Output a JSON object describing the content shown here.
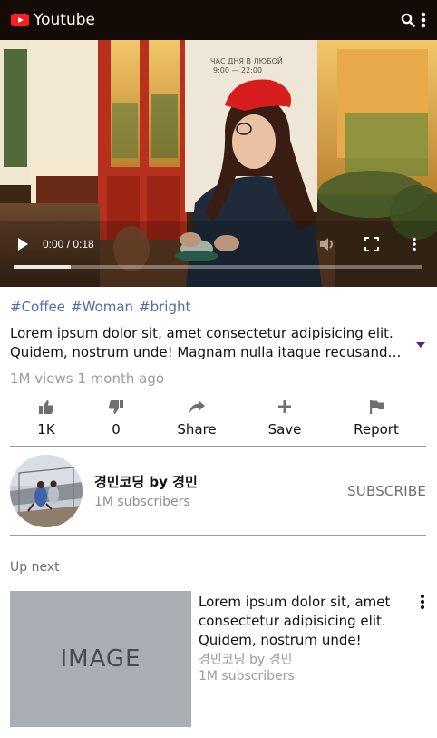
{
  "header": {
    "brand": "Youtube",
    "logo_icon": "youtube-logo-icon",
    "search_icon": "search-icon",
    "menu_icon": "more-vertical-icon"
  },
  "player": {
    "time": "0:00 / 0:18",
    "progress": 0.14
  },
  "video": {
    "tags": [
      "#Coffee",
      "#Woman",
      "#bright"
    ],
    "description_line1": "Lorem ipsum dolor sit, amet consectetur adipisicing elit.",
    "description_line2": "Quidem, nostrum unde! Magnam nulla itaque recusandae...",
    "meta": "1M views 1 month ago"
  },
  "actions": [
    {
      "icon": "thumbs-up-icon",
      "label": "1K"
    },
    {
      "icon": "thumbs-down-icon",
      "label": "0"
    },
    {
      "icon": "share-icon",
      "label": "Share"
    },
    {
      "icon": "plus-icon",
      "label": "Save"
    },
    {
      "icon": "flag-icon",
      "label": "Report"
    }
  ],
  "channel": {
    "name": "경민코딩 by 경민",
    "subscribers": "1M subscribers",
    "subscribe_label": "SUBSCRIBE"
  },
  "up_next": {
    "heading": "Up next",
    "items": [
      {
        "thumbnail_text": "IMAGE",
        "title": "Lorem ipsum dolor sit, amet consectetur adipisicing elit. Quidem, nostrum unde!",
        "channel": "경민코딩 by 경민",
        "subscribers": "1M subscribers"
      }
    ]
  },
  "colors": {
    "header_bg": "#140b06",
    "brand_red": "#ff1d1d",
    "tag_blue": "#4e6ea8",
    "muted_gray": "#9b9b9b"
  }
}
